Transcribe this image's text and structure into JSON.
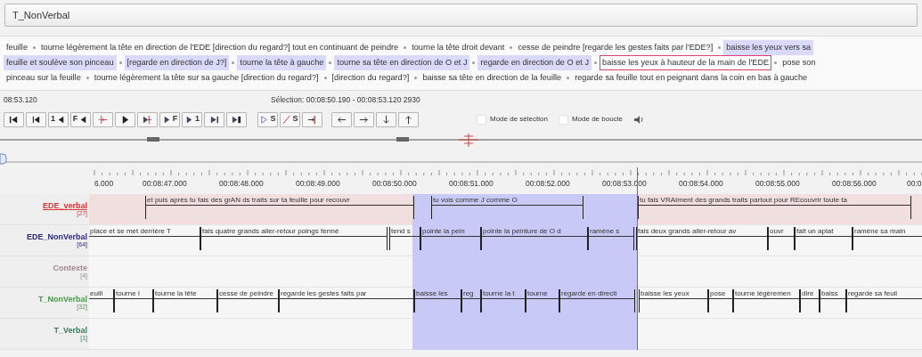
{
  "window": {
    "title": "T_NonVerbal"
  },
  "text_view": {
    "lines": [
      [
        {
          "text": "feuille",
          "highlighted": false,
          "selected": false
        },
        {
          "text": "tourne légèrement la tête en direction de l'EDE [direction du regard?] tout en continuant de peindre",
          "highlighted": false,
          "selected": false
        },
        {
          "text": "tourne la tête droit devant",
          "highlighted": false,
          "selected": false
        },
        {
          "text": "cesse de peindre [regarde les gestes faits par l'EDE?]",
          "highlighted": false,
          "selected": false
        },
        {
          "text": "baisse les yeux vers sa",
          "highlighted": true,
          "selected": false
        }
      ],
      [
        {
          "text": "feuille et soulève son pinceau",
          "highlighted": true,
          "selected": false
        },
        {
          "text": "[regarde en direction de J?]",
          "highlighted": true,
          "selected": false
        },
        {
          "text": "tourne la tête à gauche",
          "highlighted": true,
          "selected": false
        },
        {
          "text": "tourne sa tête en direction de O et J",
          "highlighted": true,
          "selected": false
        },
        {
          "text": "regarde en direction de O et J",
          "highlighted": true,
          "selected": false
        },
        {
          "text": "baisse les yeux à hauteur de la main de l'EDE",
          "highlighted": false,
          "selected": true
        },
        {
          "text": "pose son",
          "highlighted": false,
          "selected": false
        }
      ],
      [
        {
          "text": "pinceau sur la feuille",
          "highlighted": false,
          "selected": false
        },
        {
          "text": "tourne légèrement la tête sur sa gauche [direction du regard?]",
          "highlighted": false,
          "selected": false
        },
        {
          "text": "[direction du regard?]",
          "highlighted": false,
          "selected": false
        },
        {
          "text": "baisse sa tête en direction de la feuille",
          "highlighted": false,
          "selected": false
        },
        {
          "text": "regarde sa feuille tout en peignant dans la coin en bas à gauche",
          "highlighted": false,
          "selected": false
        }
      ]
    ]
  },
  "player": {
    "time": "08:53.120",
    "selection": "Sélection: 00:08:50.190 - 00:08:53.120  2930",
    "buttons": [
      {
        "kind": "go-to-begin"
      },
      {
        "kind": "previous-page"
      },
      {
        "kind": "step-back",
        "label": "1"
      },
      {
        "kind": "step-back",
        "label": "F"
      },
      {
        "kind": "selection-begin"
      },
      {
        "kind": "play"
      },
      {
        "kind": "play-selection"
      },
      {
        "kind": "step-forward",
        "label": "F"
      },
      {
        "kind": "step-forward",
        "label": "1"
      },
      {
        "kind": "next-page"
      },
      {
        "kind": "go-to-end"
      }
    ],
    "selection_buttons": [
      {
        "kind": "play-selection-outline",
        "label": "S"
      },
      {
        "kind": "clear-selection",
        "label": "S"
      },
      {
        "kind": "selection-end"
      }
    ],
    "nav_buttons": [
      {
        "kind": "left"
      },
      {
        "kind": "right"
      },
      {
        "kind": "down"
      },
      {
        "kind": "up"
      }
    ],
    "options": [
      {
        "label": "Mode de sélection",
        "checked": false
      },
      {
        "label": "Mode de boucle",
        "checked": false
      }
    ]
  },
  "timeline": {
    "ruler": [
      "6.000",
      "00:08:47.000",
      "00:08:48.000",
      "00:08:49.000",
      "00:08:50.000",
      "00:08:51.000",
      "00:08:52.000",
      "00:08:53.000",
      "00:08:54.000",
      "00:08:55.000",
      "00:08:56.000",
      "00:0"
    ],
    "tiers": [
      {
        "name": "EDE_verbal",
        "count": "[27]",
        "color": "#e03030",
        "selected": true,
        "annotations": [
          "et puis après tu fais des grAN ds traits sur ta feuille pour recouvr",
          "tu vois comme J comme O",
          "tu fais VRAIment des grands traits partout pour REcouvrir toute ta"
        ]
      },
      {
        "name": "EDE_NonVerbal",
        "count": "[64]",
        "color": "#2a2a80",
        "selected": false,
        "annotations": [
          "place et se met derrière T",
          "fais quatre grands aller-retour poings fermé",
          "tend s",
          "pointe la pein",
          "pointe la peinture de O d",
          "ramène s",
          "fais deux grands aller-retour av",
          "ouvr",
          "fait un aplat",
          "ramène sa main"
        ]
      },
      {
        "name": "Contexte",
        "count": "[4]",
        "color": "#a08890",
        "selected": false
      },
      {
        "name": "T_NonVerbal",
        "count": "[32]",
        "color": "#4a9a4a",
        "selected": false,
        "annotations": [
          "euill",
          "tourne l",
          "tourne la tête",
          "cesse de peindre",
          "regarde les gestes faits par",
          "baisse les",
          "reg",
          "tourne la t",
          "tourne",
          "regarde en directi",
          "baisse les yeux",
          "pose",
          "tourne légèremen",
          "dire",
          "baiss",
          "regarde sa feuil"
        ]
      },
      {
        "name": "T_Verbal",
        "count": "[1]",
        "color": "#3a7a5a",
        "selected": false
      }
    ]
  }
}
